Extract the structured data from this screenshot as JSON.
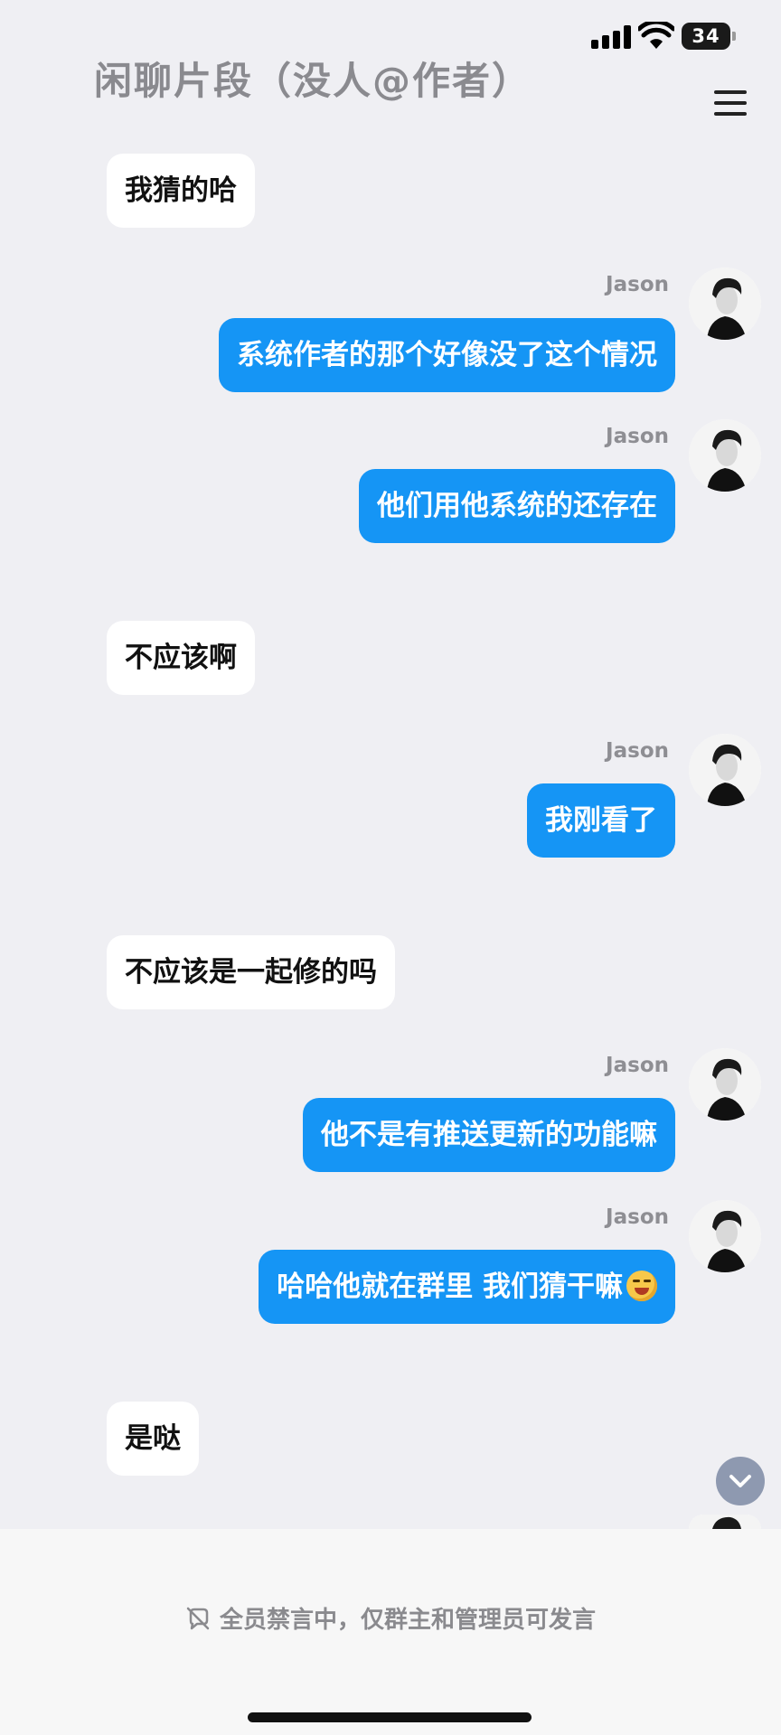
{
  "status_bar": {
    "battery": "34"
  },
  "header": {
    "title": "闲聊片段（没人@作者）",
    "menu_icon": "hamburger-menu-icon"
  },
  "messages": [
    {
      "side": "in",
      "text": "我猜的哈"
    },
    {
      "side": "out",
      "sender": "Jason",
      "text": "系统作者的那个好像没了这个情况"
    },
    {
      "side": "out",
      "sender": "Jason",
      "text": "他们用他系统的还存在"
    },
    {
      "side": "in",
      "text": "不应该啊"
    },
    {
      "side": "out",
      "sender": "Jason",
      "text": "我刚看了"
    },
    {
      "side": "in",
      "text": "不应该是一起修的吗"
    },
    {
      "side": "out",
      "sender": "Jason",
      "text": "他不是有推送更新的功能嘛"
    },
    {
      "side": "out",
      "sender": "Jason",
      "text": "哈哈他就在群里 我们猜干嘛",
      "emoji": "laughing-emoji"
    },
    {
      "side": "in",
      "text": "是哒"
    }
  ],
  "scroll_button_icon": "chevron-down-icon",
  "footer": {
    "notice": "全员禁言中，仅群主和管理员可发言",
    "notice_icon": "mute-icon"
  },
  "colors": {
    "outgoing_bubble": "#1595f5",
    "incoming_bubble": "#ffffff",
    "background": "#efeff3"
  }
}
